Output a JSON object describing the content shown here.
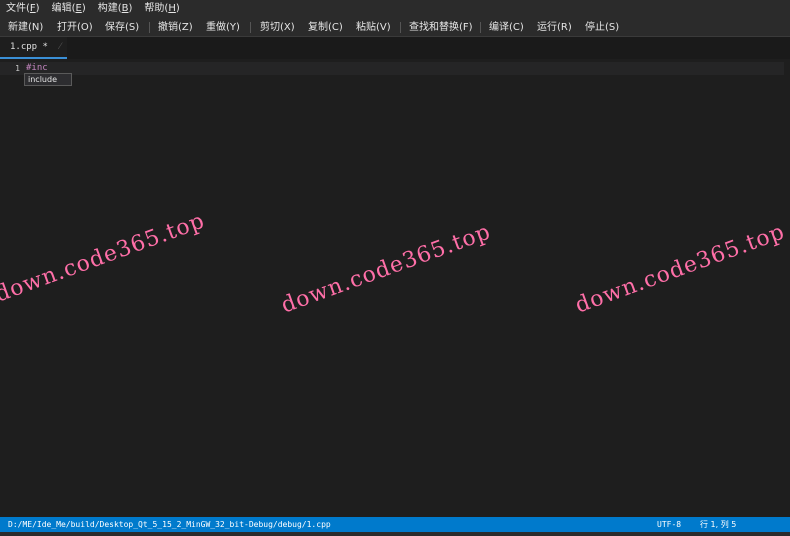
{
  "menubar": {
    "items": [
      {
        "label": "文件(",
        "key": "F",
        "end": ")"
      },
      {
        "label": "编辑(",
        "key": "E",
        "end": ")"
      },
      {
        "label": "构建(",
        "key": "B",
        "end": ")"
      },
      {
        "label": "帮助(",
        "key": "H",
        "end": ")"
      }
    ]
  },
  "toolbar": {
    "new": "新建(N)",
    "open": "打开(O)",
    "save": "保存(S)",
    "undo": "撤销(Z)",
    "redo": "重做(Y)",
    "cut": "剪切(X)",
    "copy": "复制(C)",
    "paste": "粘贴(V)",
    "find_replace": "查找和替换(F)",
    "compile": "编译(C)",
    "run": "运行(R)",
    "stop": "停止(S)"
  },
  "tabs": [
    {
      "label": "1.cpp *",
      "close": "⁄"
    }
  ],
  "editor": {
    "line_number": "1",
    "code": "#inc",
    "completion": "include"
  },
  "watermark": {
    "text": "down.code365.top"
  },
  "statusbar": {
    "path": "D:/ME/Ide_Me/build/Desktop_Qt_5_15_2_MinGW_32_bit-Debug/debug/1.cpp",
    "encoding": "UTF-8",
    "position": "行 1, 列 5"
  }
}
